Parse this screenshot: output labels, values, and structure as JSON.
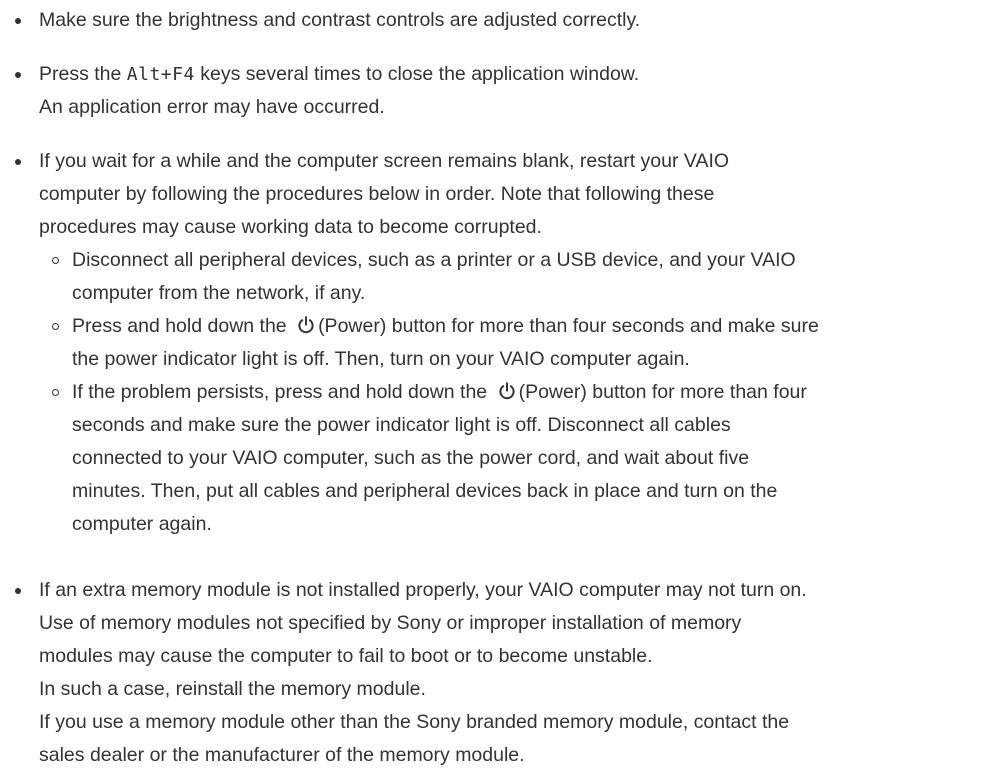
{
  "items": [
    {
      "lines": [
        "Make sure the brightness and contrast controls are adjusted correctly."
      ]
    },
    {
      "pre": "Press the ",
      "key": "Alt+F4",
      "post": " keys several times to close the application window.",
      "line2": "An application error may have occurred."
    },
    {
      "lines": [
        "If you wait for a while and the computer screen remains blank, restart your VAIO",
        "computer by following the procedures below in order. Note that following these",
        "procedures may cause working data to become corrupted."
      ],
      "sub": [
        {
          "lines": [
            "Disconnect all peripheral devices, such as a printer or a USB device, and your VAIO",
            "computer from the network, if any."
          ]
        },
        {
          "pre": "Press and hold down the ",
          "icon": "power-icon",
          "post": "(Power) button for more than four seconds and make sure",
          "line2": "the power indicator light is off. Then, turn on your VAIO computer again."
        },
        {
          "pre": "If the problem persists, press and hold down the ",
          "icon": "power-icon",
          "post": "(Power) button for more than four",
          "lines": [
            "seconds and make sure the power indicator light is off. Disconnect all cables",
            "connected to your VAIO computer, such as the power cord, and wait about five",
            "minutes. Then, put all cables and peripheral devices back in place and turn on the",
            "computer again."
          ]
        }
      ]
    },
    {
      "lines": [
        "If an extra memory module is not installed properly, your VAIO computer may not turn on.",
        "Use of memory modules not specified by Sony or improper installation of memory",
        "modules may cause the computer to fail to boot or to become unstable.",
        "In such a case, reinstall the memory module.",
        "If you use a memory module other than the Sony branded memory module, contact the",
        "sales dealer or the manufacturer of the memory module."
      ]
    }
  ]
}
